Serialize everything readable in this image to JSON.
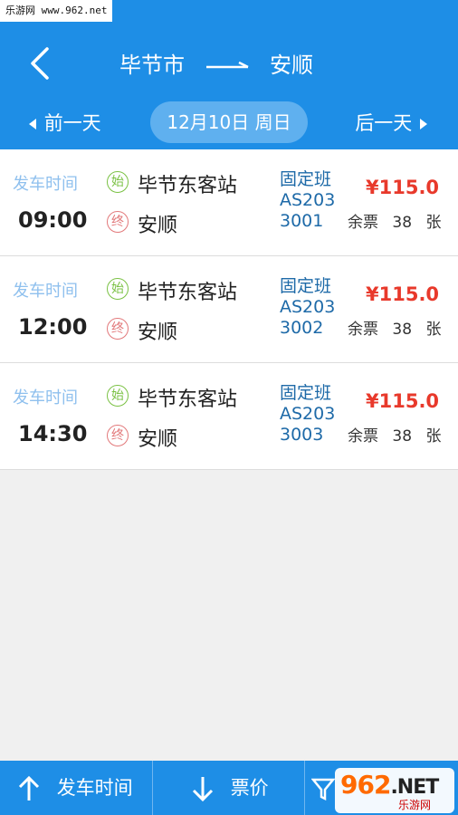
{
  "watermark": {
    "site": "乐游网 www.962.net",
    "logo_main": "962",
    "logo_net": ".NET",
    "logo_sub": "乐游网"
  },
  "header": {
    "from": "毕节市",
    "to": "安顺"
  },
  "datebar": {
    "prev": "前一天",
    "date": "12月10日 周日",
    "next": "后一天"
  },
  "trips": [
    {
      "depart_label": "发车时间",
      "time": "09:00",
      "start_badge": "始",
      "end_badge": "终",
      "from": "毕节东客站",
      "to": "安顺",
      "type": "固定班",
      "code1": "AS203",
      "code2": "3001",
      "price": "¥115.0",
      "remain_label": "余票",
      "remain_count": "38",
      "remain_unit": "张"
    },
    {
      "depart_label": "发车时间",
      "time": "12:00",
      "start_badge": "始",
      "end_badge": "终",
      "from": "毕节东客站",
      "to": "安顺",
      "type": "固定班",
      "code1": "AS203",
      "code2": "3002",
      "price": "¥115.0",
      "remain_label": "余票",
      "remain_count": "38",
      "remain_unit": "张"
    },
    {
      "depart_label": "发车时间",
      "time": "14:30",
      "start_badge": "始",
      "end_badge": "终",
      "from": "毕节东客站",
      "to": "安顺",
      "type": "固定班",
      "code1": "AS203",
      "code2": "3003",
      "price": "¥115.0",
      "remain_label": "余票",
      "remain_count": "38",
      "remain_unit": "张"
    }
  ],
  "bottom": {
    "sort_time": "发车时间",
    "sort_price": "票价"
  },
  "colors": {
    "header": "#1e8ee6",
    "price": "#e8392b",
    "start": "#7ac143",
    "end": "#e2787a"
  }
}
